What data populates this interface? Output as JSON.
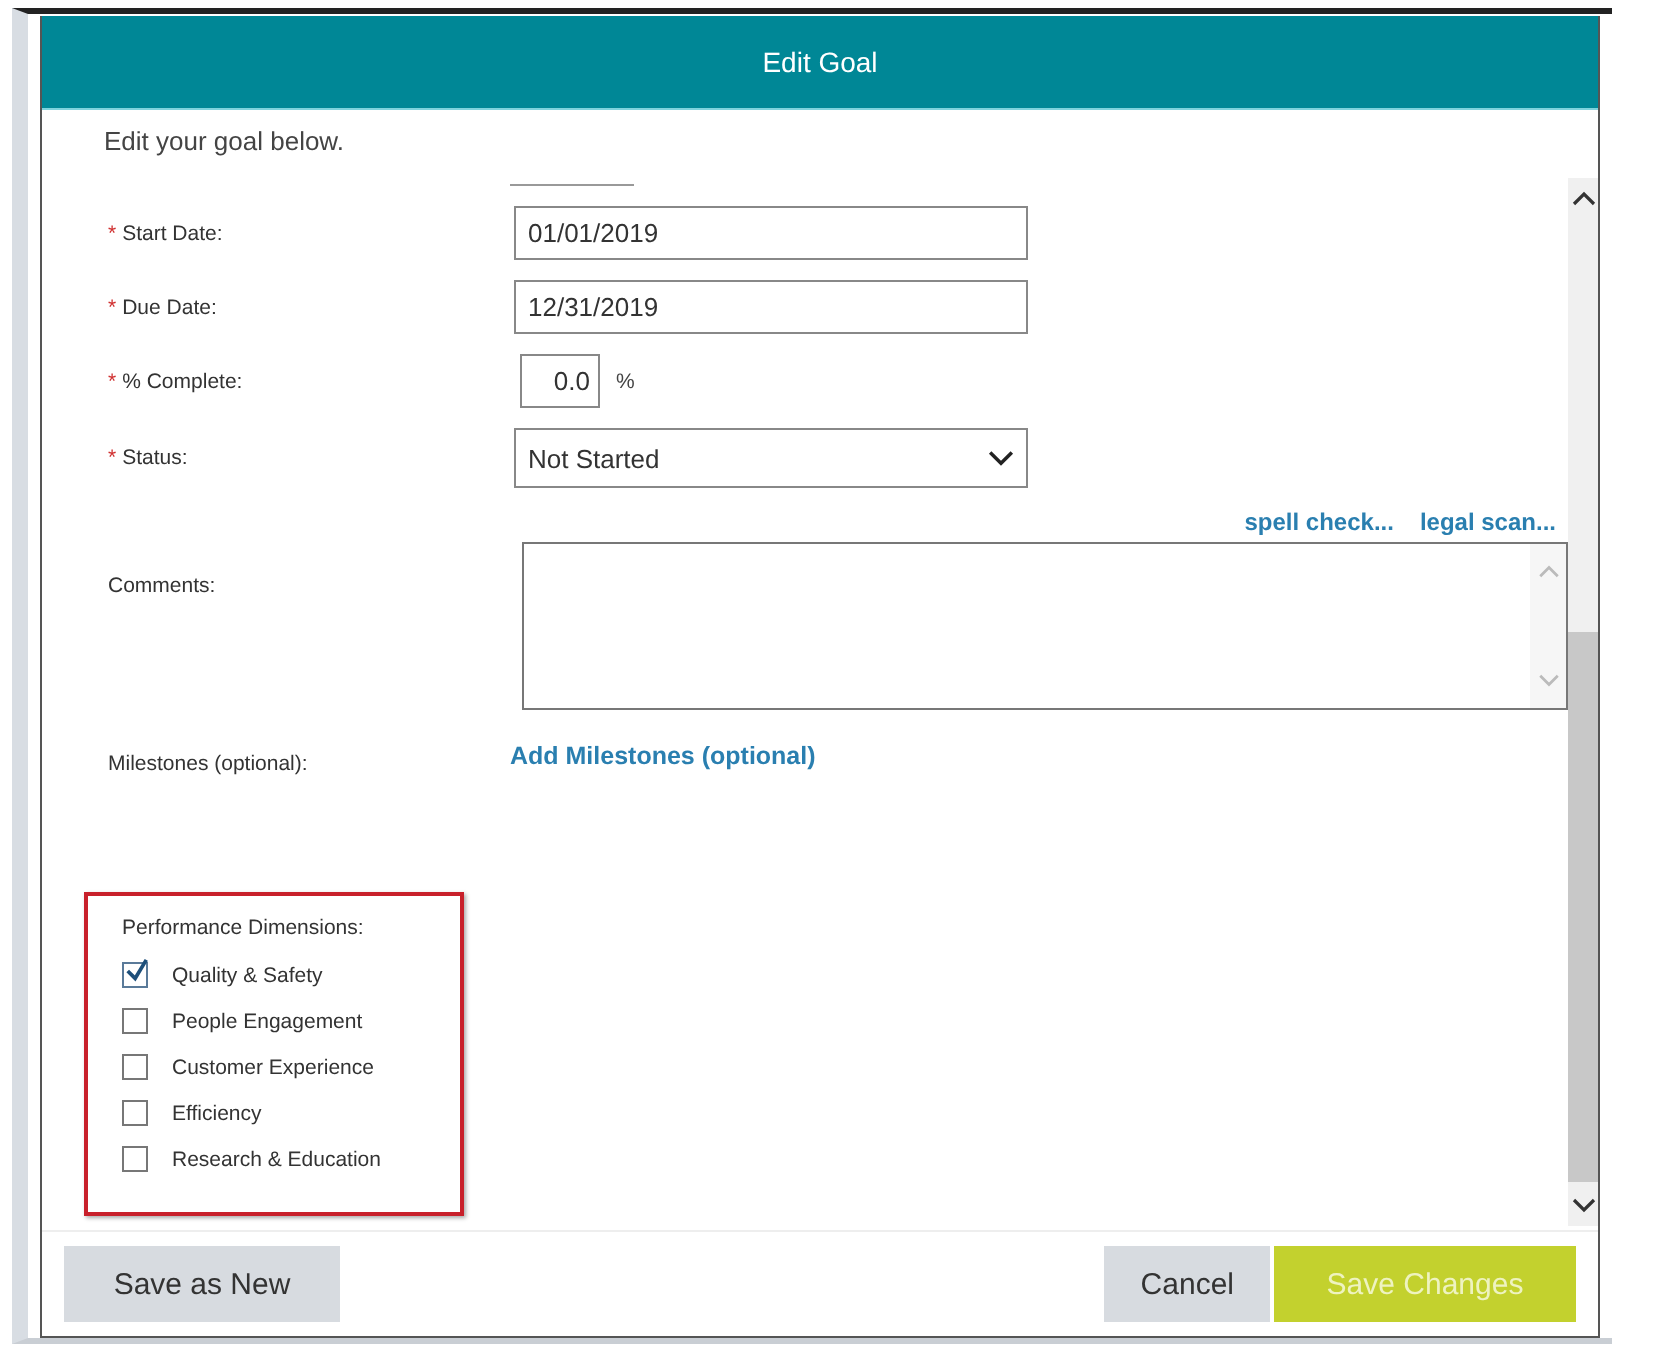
{
  "dialog": {
    "title": "Edit Goal",
    "intro": "Edit your goal below."
  },
  "fields": [
    {
      "kind": "text",
      "marker": "*",
      "label": "Start Date:",
      "value": "01/01/2019"
    },
    {
      "kind": "text",
      "marker": "*",
      "label": "Due Date:",
      "value": "12/31/2019"
    },
    {
      "kind": "percent",
      "marker": "*",
      "label": "% Complete:",
      "value": "0.0",
      "unit": "%"
    },
    {
      "kind": "select",
      "marker": "*",
      "label": "Status:",
      "value": "Not Started"
    },
    {
      "kind": "textarea",
      "label": "Comments:",
      "links": [
        "spell check...",
        "legal scan..."
      ]
    },
    {
      "kind": "link",
      "label": "Milestones (optional):",
      "link": "Add Milestones (optional)"
    }
  ],
  "dimensions": {
    "title": "Performance Dimensions:",
    "items": [
      {
        "label": "Quality & Safety",
        "checked": true
      },
      {
        "label": "People Engagement",
        "checked": false
      },
      {
        "label": "Customer Experience",
        "checked": false
      },
      {
        "label": "Efficiency",
        "checked": false
      },
      {
        "label": "Research & Education",
        "checked": false
      }
    ]
  },
  "buttons": [
    {
      "kind": "secondary",
      "label": "Save as New"
    },
    {
      "kind": "secondary",
      "label": "Cancel"
    },
    {
      "kind": "primary",
      "label": "Save Changes"
    }
  ]
}
